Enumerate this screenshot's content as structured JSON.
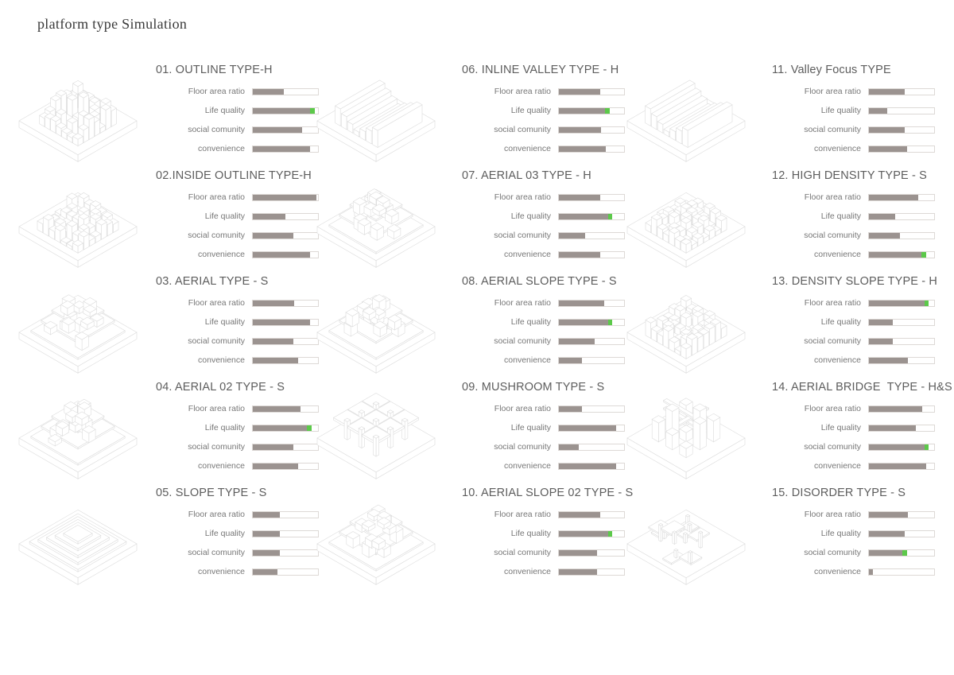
{
  "page": {
    "title": "platform type Simulation"
  },
  "metric_labels": [
    "Floor area ratio",
    "Life quality",
    "social comunity",
    "convenience"
  ],
  "colors": {
    "bar_fill": "#9b9390",
    "bar_highlight": "#5cc94a",
    "bar_track_border": "#ddd9d6",
    "model_line": "#dcdcdc",
    "text": "#6b6b6b",
    "title_text": "#3a3a3a"
  },
  "chart_data": {
    "type": "bar",
    "title": "platform type Simulation",
    "categories": [
      "Floor area ratio",
      "Life quality",
      "social comunity",
      "convenience"
    ],
    "xlim": [
      0,
      100
    ],
    "grid": false,
    "legend": null,
    "note": "Each panel is a 4-row horizontal progress-bar set; values are percent of track width. 'highlight' is the percent at which a green segment ends (green segment occupies the last ~8% before that point).",
    "panels": [
      {
        "id": "01",
        "title": "01. OUTLINE TYPE-H",
        "model": "outline-type-h",
        "values": [
          48,
          95,
          75,
          88
        ],
        "highlight": [
          null,
          95,
          null,
          null
        ]
      },
      {
        "id": "02",
        "title": "02.INSIDE OUTLINE TYPE-H",
        "model": "inside-outline-type-h",
        "values": [
          97,
          50,
          62,
          88
        ],
        "highlight": [
          null,
          null,
          null,
          null
        ]
      },
      {
        "id": "03",
        "title": "03. AERIAL TYPE - S",
        "model": "aerial-type-s",
        "values": [
          63,
          88,
          62,
          70
        ],
        "highlight": [
          null,
          null,
          null,
          null
        ]
      },
      {
        "id": "04",
        "title": "04. AERIAL 02 TYPE - S",
        "model": "aerial-02-type-s",
        "values": [
          73,
          90,
          62,
          70
        ],
        "highlight": [
          null,
          90,
          null,
          null
        ]
      },
      {
        "id": "05",
        "title": "05. SLOPE TYPE - S",
        "model": "slope-type-s",
        "values": [
          42,
          42,
          42,
          38
        ],
        "highlight": [
          null,
          null,
          null,
          null
        ]
      },
      {
        "id": "06",
        "title": "06. INLINE VALLEY TYPE - H",
        "model": "inline-valley-type-h",
        "values": [
          63,
          78,
          65,
          72
        ],
        "highlight": [
          null,
          78,
          null,
          null
        ]
      },
      {
        "id": "07",
        "title": "07. AERIAL 03 TYPE - H",
        "model": "aerial-03-type-h",
        "values": [
          63,
          82,
          40,
          63
        ],
        "highlight": [
          null,
          82,
          null,
          null
        ]
      },
      {
        "id": "08",
        "title": "08. AERIAL SLOPE TYPE - S",
        "model": "aerial-slope-type-s",
        "values": [
          70,
          82,
          55,
          35
        ],
        "highlight": [
          null,
          82,
          null,
          null
        ]
      },
      {
        "id": "09",
        "title": "09. MUSHROOM TYPE - S",
        "model": "mushroom-type-s",
        "values": [
          35,
          88,
          30,
          88
        ],
        "highlight": [
          null,
          null,
          null,
          null
        ]
      },
      {
        "id": "10",
        "title": "10. AERIAL SLOPE 02 TYPE - S",
        "model": "aerial-slope-02-type-s",
        "values": [
          63,
          82,
          58,
          58
        ],
        "highlight": [
          null,
          82,
          null,
          null
        ]
      },
      {
        "id": "11",
        "title": "11. Valley Focus TYPE",
        "model": "valley-focus-type",
        "values": [
          55,
          28,
          55,
          58
        ],
        "highlight": [
          null,
          null,
          null,
          null
        ]
      },
      {
        "id": "12",
        "title": "12. HIGH DENSITY TYPE - S",
        "model": "high-density-type-s",
        "values": [
          76,
          40,
          48,
          88
        ],
        "highlight": [
          null,
          null,
          null,
          88
        ]
      },
      {
        "id": "13",
        "title": "13. DENSITY SLOPE TYPE - H",
        "model": "density-slope-type-h",
        "values": [
          92,
          37,
          37,
          60
        ],
        "highlight": [
          92,
          null,
          null,
          null
        ]
      },
      {
        "id": "14",
        "title": "14. AERIAL BRIDGE  TYPE - H&S",
        "model": "aerial-bridge-type-hs",
        "values": [
          82,
          72,
          92,
          88
        ],
        "highlight": [
          null,
          null,
          92,
          null
        ]
      },
      {
        "id": "15",
        "title": "15. DISORDER TYPE - S",
        "model": "disorder-type-s",
        "values": [
          60,
          55,
          58,
          6
        ],
        "highlight": [
          null,
          null,
          58,
          null
        ]
      }
    ]
  }
}
